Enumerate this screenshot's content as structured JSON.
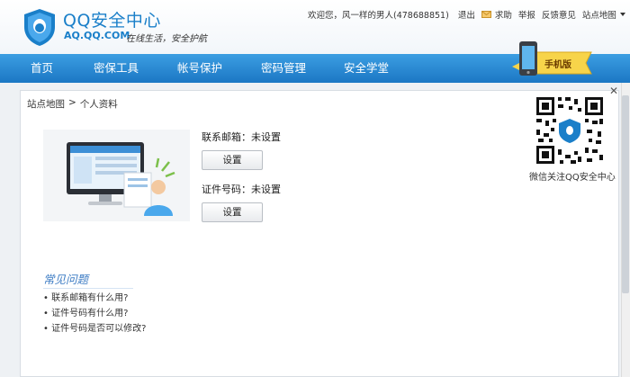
{
  "brand": {
    "title": "QQ安全中心",
    "domain": "AQ.QQ.COM",
    "slogan": "在线生活，安全护航",
    "colors": {
      "brand_blue": "#1a7fc9",
      "nav_blue": "#2585d0"
    }
  },
  "toplinks": {
    "welcome": "欢迎您，风一样的男人(478688851)",
    "logout": "退出",
    "help": "求助",
    "report": "举报",
    "feedback": "反馈意见",
    "sitemap": "站点地图"
  },
  "nav": {
    "items": [
      "首页",
      "密保工具",
      "帐号保护",
      "密码管理",
      "安全学堂"
    ],
    "phone_banner": "手机版"
  },
  "breadcrumb": {
    "root": "站点地图",
    "sep": ">",
    "current": "个人资料"
  },
  "profile": {
    "email_label": "联系邮箱：未设置",
    "email_button": "设置",
    "id_label": "证件号码：未设置",
    "id_button": "设置"
  },
  "qr": {
    "caption": "微信关注QQ安全中心"
  },
  "faq": {
    "title": "常见问题",
    "items": [
      "联系邮箱有什么用?",
      "证件号码有什么用?",
      "证件号码是否可以修改?"
    ]
  },
  "close_symbol": "✕"
}
